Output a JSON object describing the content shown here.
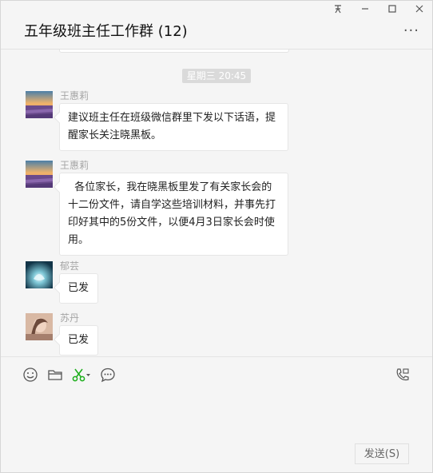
{
  "window": {
    "title": "五年级班主任工作群 (12)",
    "pin_glyph": "ᅎ",
    "minimize_glyph": "—",
    "maximize_glyph": "☐",
    "close_glyph": "✕",
    "more_glyph": "···"
  },
  "chat": {
    "timestamp": "星期三 20:45",
    "messages": [
      {
        "sender": "王惠莉",
        "text": "建议班主任在班级微信群里下发以下话语，提醒家长关注晓黑板。",
        "avatar": "lavender-field"
      },
      {
        "sender": "王惠莉",
        "text": "  各位家长，我在晓黑板里发了有关家长会的十二份文件，请自学这些培训材料，并事先打印好其中的5份文件，以便4月3日家长会时使用。",
        "avatar": "lavender-field"
      },
      {
        "sender": "郁芸",
        "text": "已发",
        "avatar": "glowing-lotus"
      },
      {
        "sender": "苏丹",
        "text": "已发",
        "avatar": "portrait-photo"
      }
    ]
  },
  "toolbar": {
    "icons": [
      "emoji-icon",
      "folder-icon",
      "screenshot-scissors-icon",
      "chat-history-icon",
      "video-call-icon"
    ],
    "accent_color": "#1aad19"
  },
  "composer": {
    "send_label": "发送(S)"
  }
}
